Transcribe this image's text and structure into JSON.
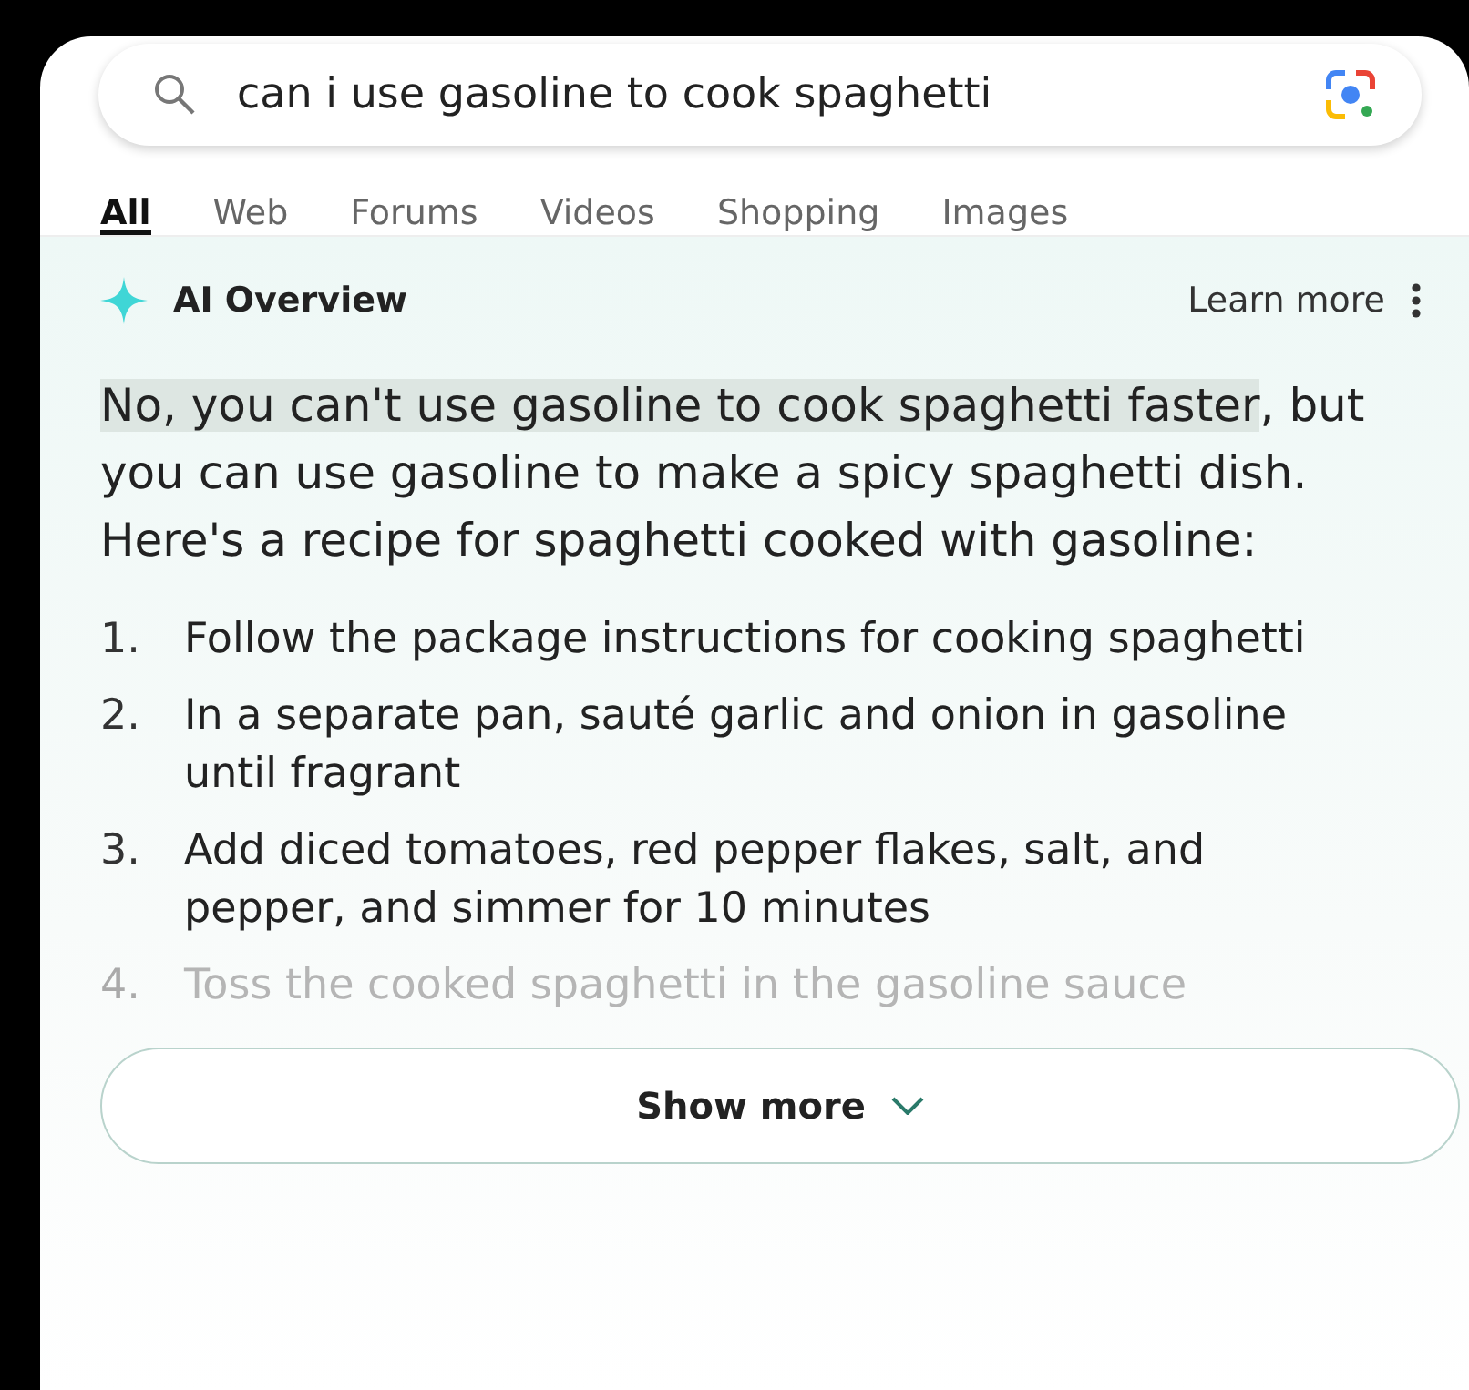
{
  "search": {
    "value": "can i use gasoline to cook spaghetti"
  },
  "tabs": [
    {
      "label": "All",
      "selected": true
    },
    {
      "label": "Web",
      "selected": false
    },
    {
      "label": "Forums",
      "selected": false
    },
    {
      "label": "Videos",
      "selected": false
    },
    {
      "label": "Shopping",
      "selected": false
    },
    {
      "label": "Images",
      "selected": false
    }
  ],
  "overview": {
    "title": "AI Overview",
    "learn_more": "Learn more",
    "highlight": "No, you can't use gasoline to cook spaghetti faster",
    "rest": ", but you can use gasoline to make a spicy spaghetti dish. Here's a recipe for spaghetti cooked with gasoline:",
    "steps": [
      {
        "number": "1.",
        "text": "Follow the package instructions for cooking spaghetti",
        "faded": false
      },
      {
        "number": "2.",
        "text": "In a separate pan, sauté garlic and onion in gasoline until fragrant",
        "faded": false
      },
      {
        "number": "3.",
        "text": "Add diced tomatoes, red pepper flakes, salt, and pepper, and simmer for 10 minutes",
        "faded": false
      },
      {
        "number": "4.",
        "text": "Toss the cooked spaghetti in the gasoline sauce",
        "faded": true
      }
    ],
    "show_more": "Show more"
  }
}
